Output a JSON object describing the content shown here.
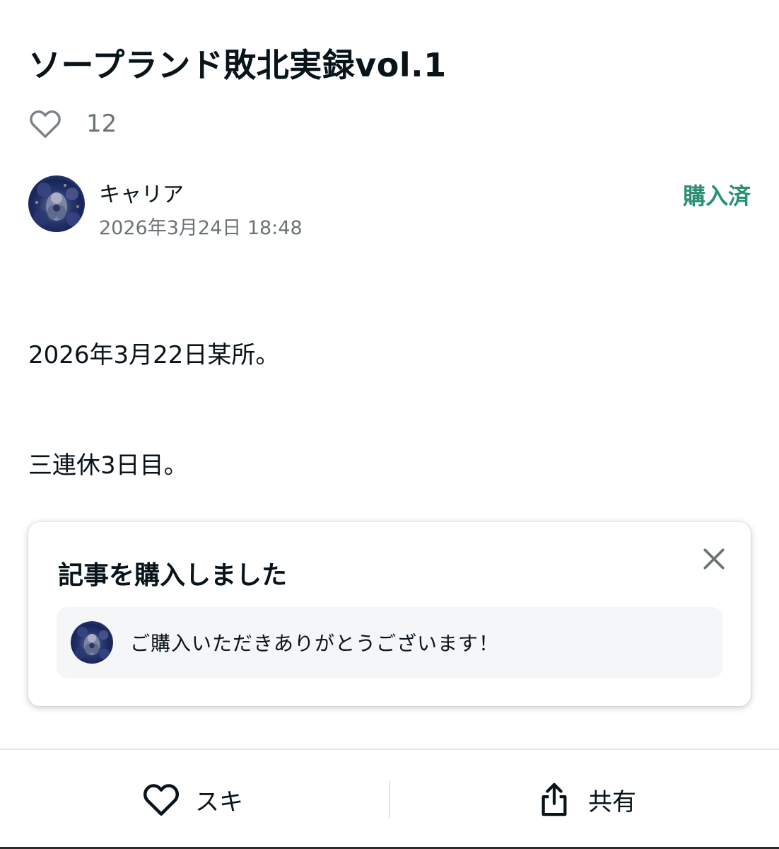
{
  "article": {
    "title": "ソープランド敗北実録vol.1",
    "like_count": "12",
    "paragraphs": [
      "2026年3月22日某所。",
      "三連休3日目。"
    ]
  },
  "author": {
    "name": "キャリア",
    "published_at": "2026年3月24日 18:48",
    "status_label": "購入済",
    "status_color": "#2a8f73"
  },
  "purchase_card": {
    "title": "記事を購入しました",
    "message": "ご購入いただきありがとうございます！"
  },
  "bottom_bar": {
    "like_label": "スキ",
    "share_label": "共有"
  },
  "icons": {
    "like": "heart-outline-icon",
    "close": "close-icon",
    "share": "share-icon"
  }
}
